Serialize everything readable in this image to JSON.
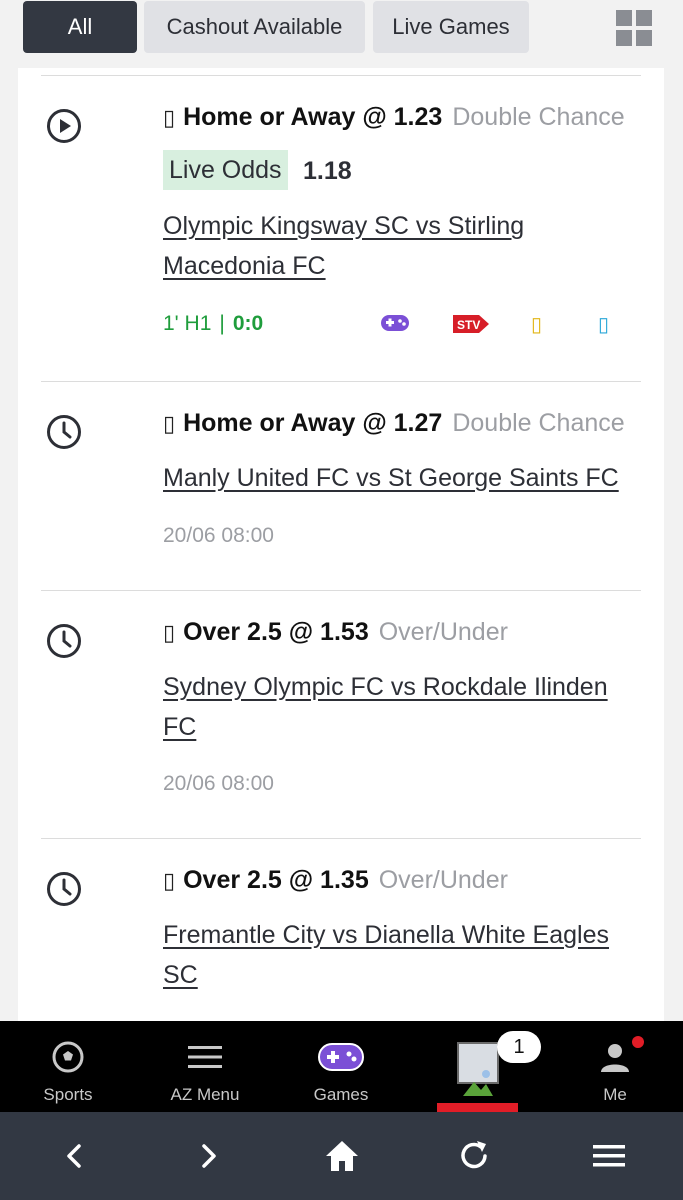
{
  "filters": {
    "all": "All",
    "cashout": "Cashout Available",
    "live": "Live Games"
  },
  "bets": [
    {
      "status_icon": "play-circle-icon",
      "selection_glyph": "▯",
      "selection": "Home or Away @ 1.23",
      "market": "Double Chance",
      "live_odds_label": "Live Odds",
      "live_odds_value": "1.18",
      "match": "Olympic Kingsway SC vs Stirling Macedonia FC",
      "clock": "1' H1",
      "separator": "|",
      "score": "0:0",
      "stream_icons": [
        "gamepad-icon",
        "stv-icon",
        "yellow-icon",
        "cyan-icon"
      ],
      "stv_label": "STV",
      "placeholder_glyph": "▯"
    },
    {
      "status_icon": "clock-icon",
      "selection_glyph": "▯",
      "selection": "Home or Away @ 1.27",
      "market": "Double Chance",
      "match": "Manly United FC vs St George Saints FC",
      "datetime": "20/06 08:00"
    },
    {
      "status_icon": "clock-icon",
      "selection_glyph": "▯",
      "selection": "Over 2.5 @ 1.53",
      "market": "Over/Under",
      "match": "Sydney Olympic FC vs Rockdale Ilinden FC",
      "datetime": "20/06 08:00"
    },
    {
      "status_icon": "clock-icon",
      "selection_glyph": "▯",
      "selection": "Over 2.5 @ 1.35",
      "market": "Over/Under",
      "match": "Fremantle City vs Dianella White Eagles SC"
    }
  ],
  "nav": {
    "sports": "Sports",
    "az_menu": "AZ Menu",
    "games": "Games",
    "betslip_count": "1",
    "me": "Me"
  },
  "colors": {
    "live_green": "#1f9d3c",
    "accent_red": "#e11d27",
    "games_purple": "#7b4fd6",
    "chip_active": "#333842"
  }
}
